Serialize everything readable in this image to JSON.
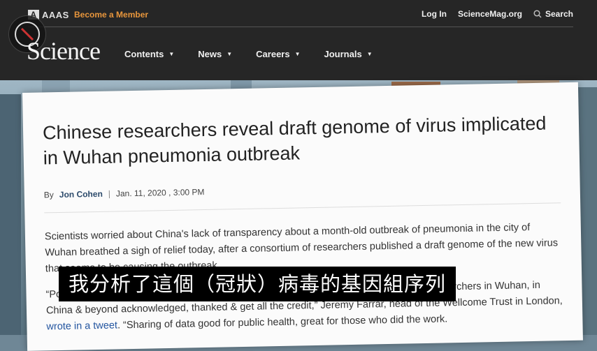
{
  "header": {
    "org": "AAAS",
    "member_link": "Become a Member",
    "login": "Log In",
    "site_link": "ScienceMag.org",
    "search_label": "Search",
    "logo": "Science",
    "nav": [
      "Contents",
      "News",
      "Careers",
      "Journals"
    ]
  },
  "article": {
    "headline": "Chinese researchers reveal draft genome of virus implicated in Wuhan pneumonia outbreak",
    "by_prefix": "By",
    "author": "Jon Cohen",
    "date": "Jan. 11, 2020 , 3:00 PM",
    "p1": "Scientists worried about China's lack of transparency about a month-old outbreak of pneumonia in the city of Wuhan breathed a sigh of relief today, after a consortium of researchers published a draft genome of the new virus that seems to be causing the outbreak.",
    "p2_a": "“Potentially really important work, that we should all be grateful for, and of course the researchers in Wuhan, in China & beyond acknowledged, thanked & get all the credit,” Jeremy Farrar, head of the Wellcome Trust in London,",
    "p2_link": "wrote in a tweet",
    "p2_b": ". “Sharing of data good for public health, great for those who did the work."
  },
  "subtitle": "我分析了這個（冠狀）病毒的基因組序列",
  "colors": {
    "header_bg": "#262626",
    "accent": "#e8963c",
    "link": "#2456a0"
  },
  "icons": {
    "search": "search-icon",
    "caret": "chevron-down-icon"
  }
}
